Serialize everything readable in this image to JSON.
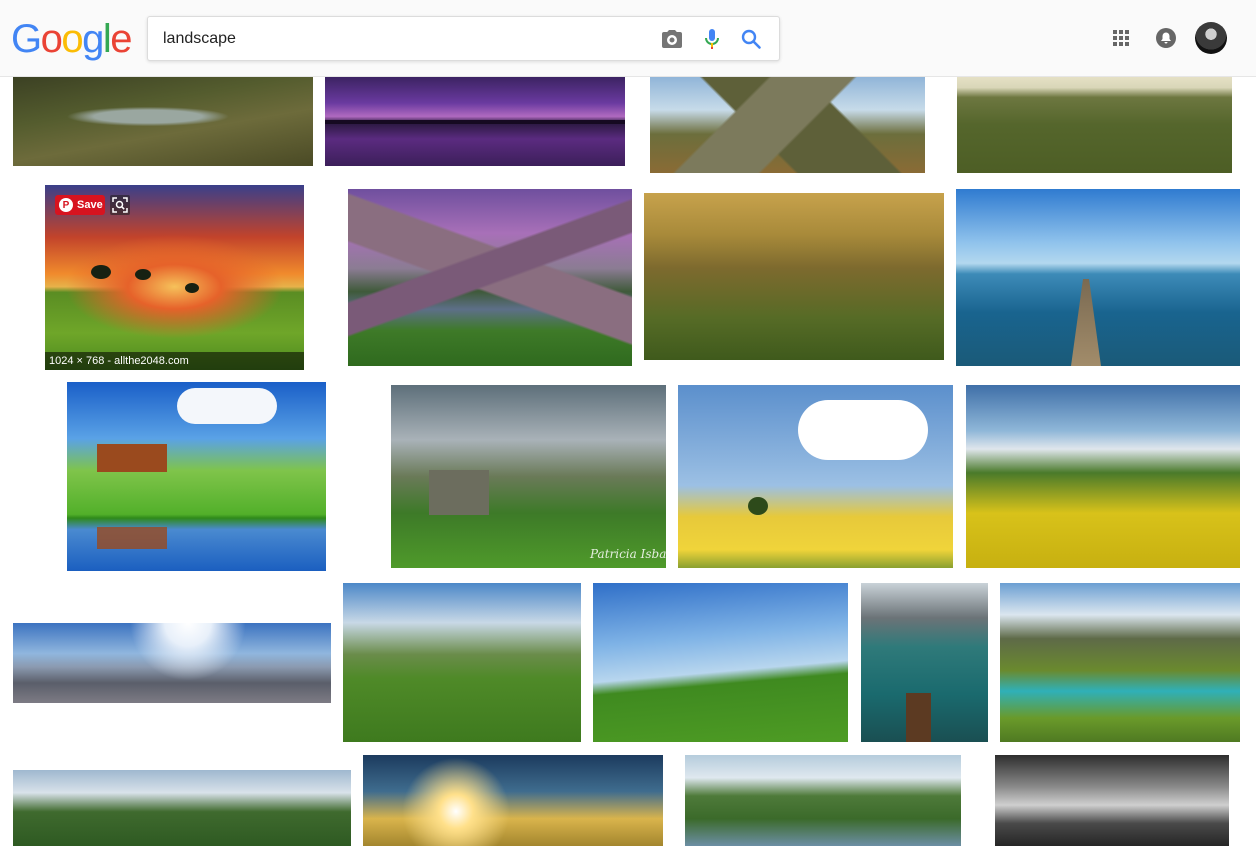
{
  "logo": {
    "letters": [
      "G",
      "o",
      "o",
      "g",
      "l",
      "e"
    ],
    "colors": [
      "#4285f4",
      "#ea4335",
      "#fbbc05",
      "#4285f4",
      "#34a853",
      "#ea4335"
    ]
  },
  "search": {
    "query": "landscape",
    "placeholder": ""
  },
  "icons": {
    "camera": "camera-icon",
    "mic": "mic-icon",
    "search": "search-icon",
    "apps": "apps-grid-icon",
    "notifications": "notifications-icon",
    "account": "account-avatar"
  },
  "hover": {
    "save_label": "Save",
    "caption": "1024 × 768 - allthe2048.com"
  },
  "watermark": "Patricia Isball",
  "images": [
    {
      "name": "result-image-1",
      "desc": "river through meadow"
    },
    {
      "name": "result-image-2",
      "desc": "purple sunset bridge"
    },
    {
      "name": "result-image-3",
      "desc": "mountain valley river"
    },
    {
      "name": "result-image-4",
      "desc": "green plain horizon"
    },
    {
      "name": "result-image-5",
      "desc": "sunset hill trees"
    },
    {
      "name": "result-image-6",
      "desc": "mountain lake purple sky"
    },
    {
      "name": "result-image-7",
      "desc": "misty golden valley"
    },
    {
      "name": "result-image-8",
      "desc": "wooden pier lake"
    },
    {
      "name": "result-image-9",
      "desc": "cabin green field reflection"
    },
    {
      "name": "result-image-10",
      "desc": "cabin forest field"
    },
    {
      "name": "result-image-11",
      "desc": "lone tree yellow field"
    },
    {
      "name": "result-image-12",
      "desc": "dandelion mountain meadow"
    },
    {
      "name": "result-image-13",
      "desc": "panoramic sun horizon"
    },
    {
      "name": "result-image-14",
      "desc": "green mountain valley"
    },
    {
      "name": "result-image-15",
      "desc": "green hill blue sky"
    },
    {
      "name": "result-image-16",
      "desc": "boats lake mountains"
    },
    {
      "name": "result-image-17",
      "desc": "alpine lake aerial"
    },
    {
      "name": "result-image-18",
      "desc": "mountain forest clouds"
    },
    {
      "name": "result-image-19",
      "desc": "sunrise horizon"
    },
    {
      "name": "result-image-20",
      "desc": "green mountain lake"
    },
    {
      "name": "result-image-21",
      "desc": "black white mountains"
    }
  ]
}
